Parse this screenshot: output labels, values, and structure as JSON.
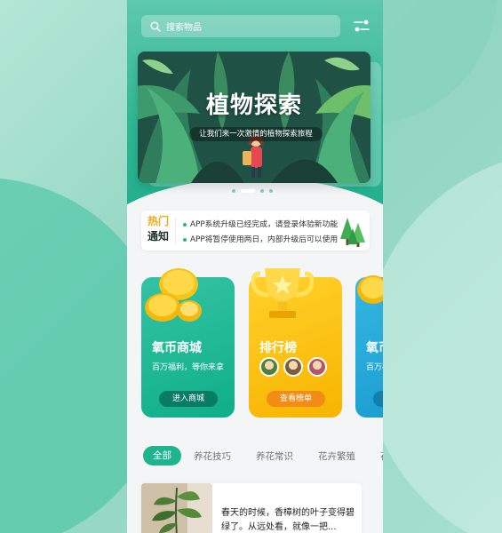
{
  "search": {
    "placeholder": "搜索物品"
  },
  "banner": {
    "title": "植物探索",
    "subtitle": "让我们来一次激情的植物探索旅程",
    "dots": 4,
    "active_dot": 1
  },
  "notice": {
    "tag_line1": "热门",
    "tag_line2": "通知",
    "items": [
      "APP系统升级已经完成，请登录体验新功能...",
      "APP将暂停使用两日，内部升级后可以使用..."
    ]
  },
  "cards": [
    {
      "title": "氧币商城",
      "subtitle": "百万福利，等你来拿",
      "button": "进入商城"
    },
    {
      "title": "排行榜",
      "subtitle": "",
      "button": "查看榜单"
    },
    {
      "title": "氧币",
      "subtitle": "百万福",
      "button": "进"
    }
  ],
  "tabs": [
    {
      "label": "全部",
      "active": true
    },
    {
      "label": "养花技巧",
      "active": false
    },
    {
      "label": "养花常识",
      "active": false
    },
    {
      "label": "花卉繁殖",
      "active": false
    },
    {
      "label": "花",
      "active": false
    }
  ],
  "article": {
    "text": "春天的时候，香樟树的叶子变得碧绿了。从远处看，就像一把..."
  },
  "colors": {
    "brand_green": "#1eb48e",
    "notice_orange": "#f0a91a",
    "card_green": "#0fae88",
    "card_yellow": "#f7b400",
    "card_blue": "#1b9dd2"
  }
}
